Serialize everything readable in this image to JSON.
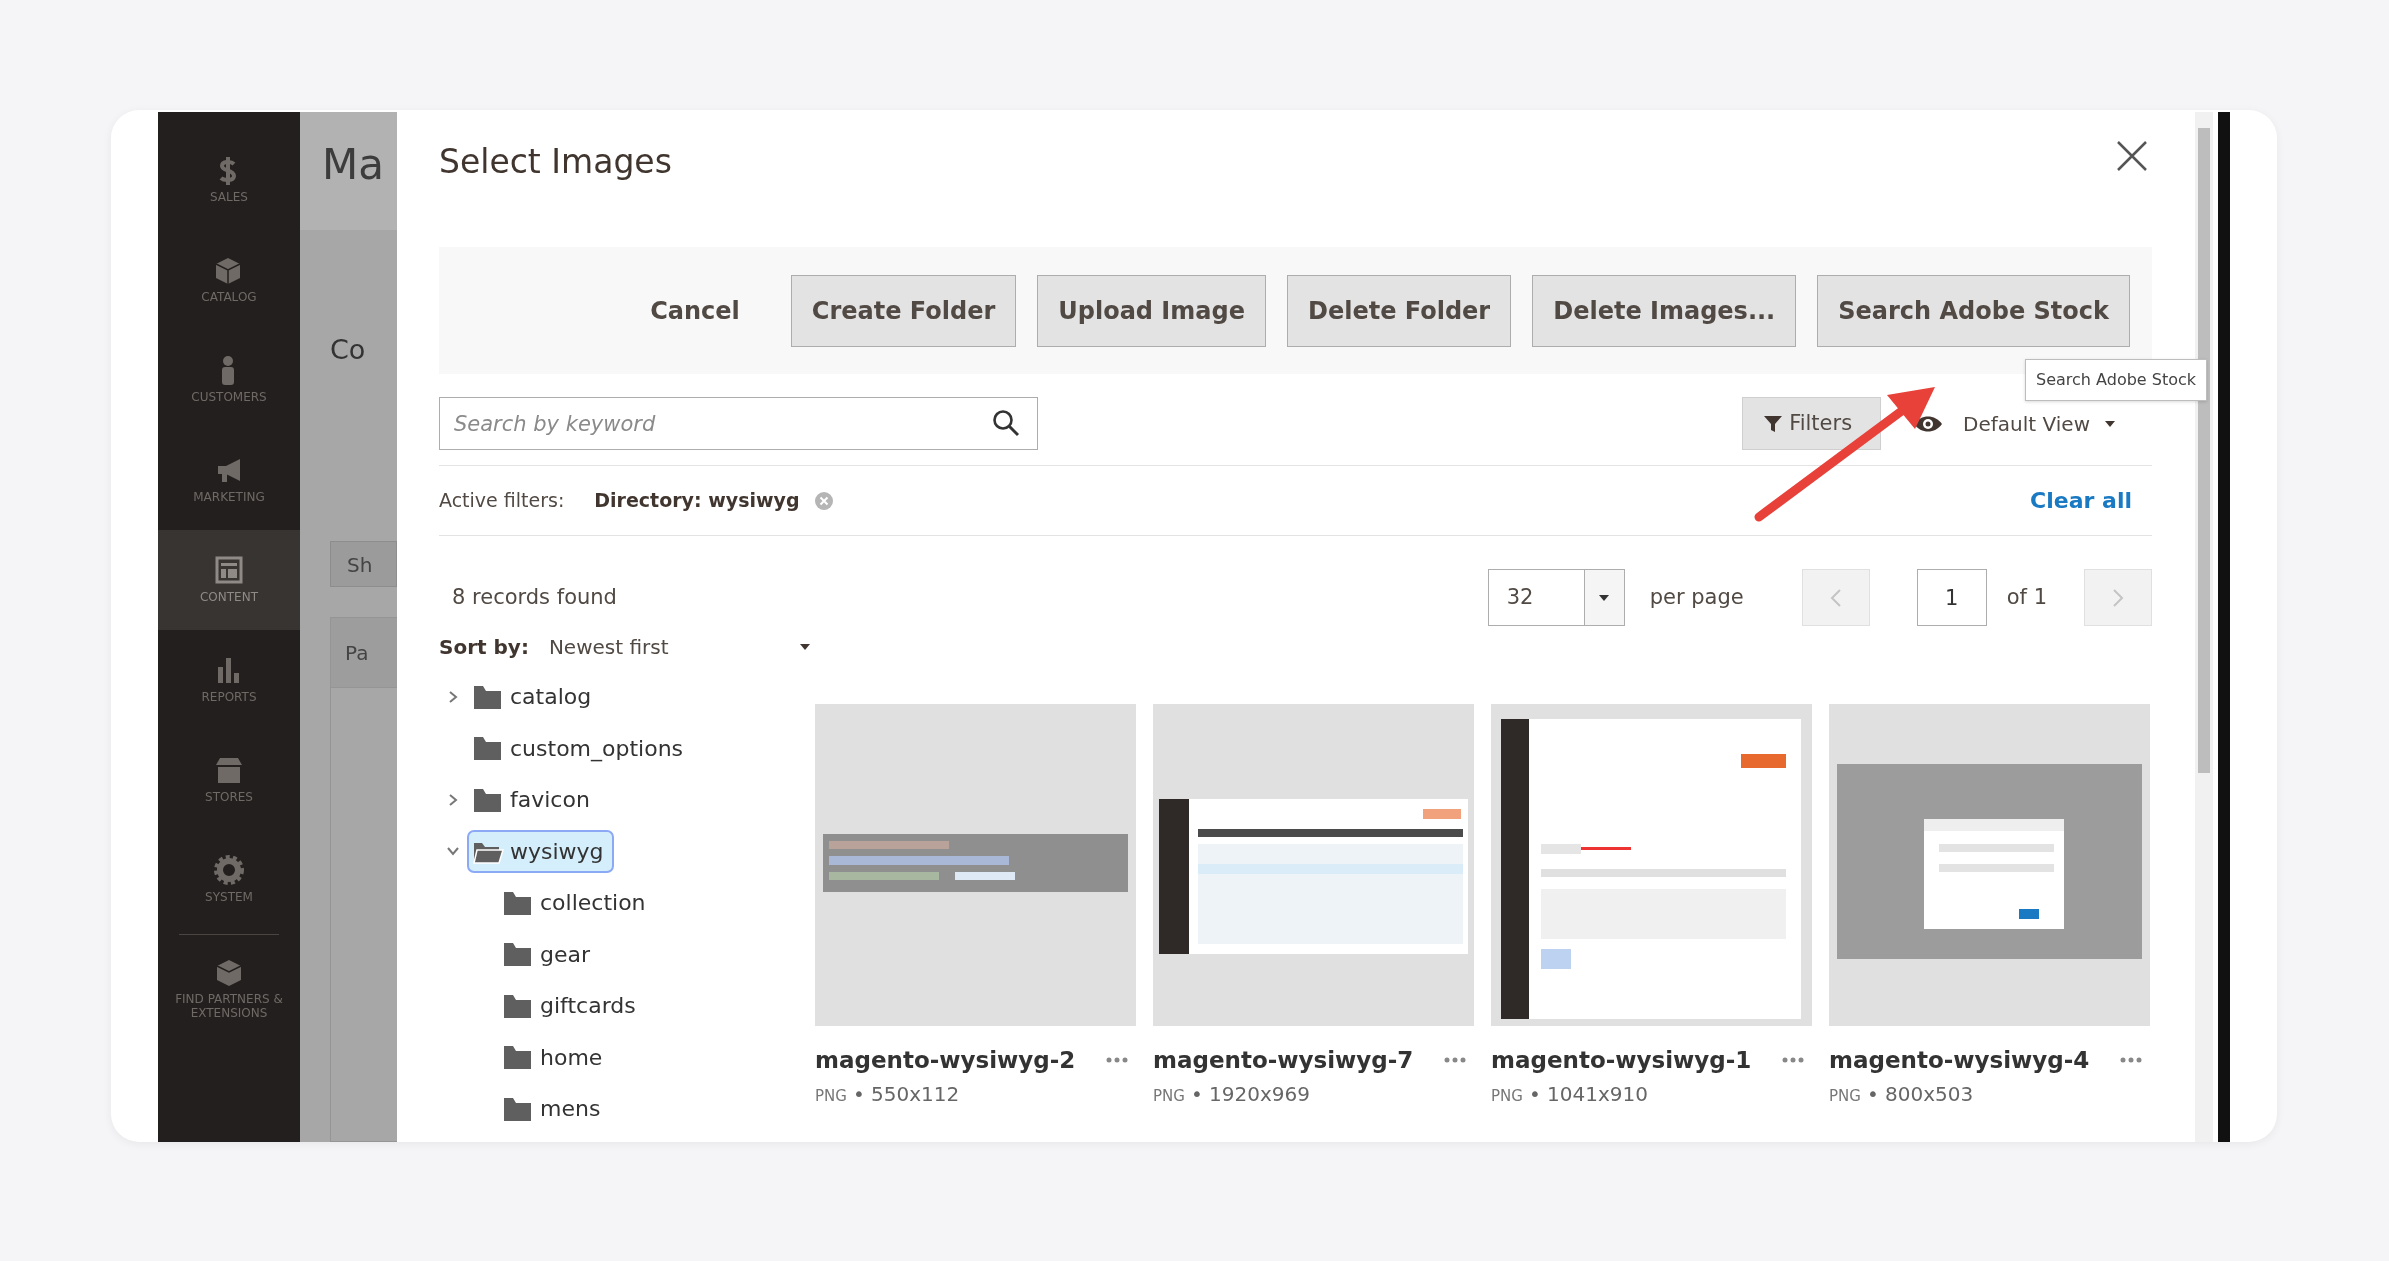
{
  "admin_sidebar": {
    "items": [
      {
        "label": "SALES",
        "selected": false
      },
      {
        "label": "CATALOG",
        "selected": false
      },
      {
        "label": "CUSTOMERS",
        "selected": false
      },
      {
        "label": "MARKETING",
        "selected": false
      },
      {
        "label": "CONTENT",
        "selected": true
      },
      {
        "label": "REPORTS",
        "selected": false
      },
      {
        "label": "STORES",
        "selected": false
      },
      {
        "label": "SYSTEM",
        "selected": false
      },
      {
        "label": "FIND PARTNERS & EXTENSIONS",
        "selected": false
      }
    ]
  },
  "background_page": {
    "title": "Ma",
    "heading": "Co",
    "button": "Sh",
    "panel_tab": "Pa"
  },
  "modal": {
    "title": "Select Images",
    "toolbar": [
      {
        "label": "Cancel",
        "kind": "link"
      },
      {
        "label": "Create Folder",
        "kind": "button"
      },
      {
        "label": "Upload Image",
        "kind": "button"
      },
      {
        "label": "Delete Folder",
        "kind": "button"
      },
      {
        "label": "Delete Images...",
        "kind": "button"
      },
      {
        "label": "Search Adobe Stock",
        "kind": "button"
      }
    ],
    "tooltip": "Search Adobe Stock",
    "search": {
      "placeholder": "Search by keyword"
    },
    "filters_button": "Filters",
    "view": "Default View",
    "active_filters": {
      "label": "Active filters:",
      "chips": [
        "Directory: wysiwyg"
      ],
      "clear": "Clear all"
    },
    "records": "8 records found",
    "per_page": {
      "value": "32",
      "label": "per page"
    },
    "pagination": {
      "page": "1",
      "of": "of 1"
    },
    "sort": {
      "label": "Sort by:",
      "value": "Newest first"
    },
    "tree": [
      {
        "label": "catalog",
        "expanded": false,
        "selected": false
      },
      {
        "label": "custom_options",
        "selected": false
      },
      {
        "label": "favicon",
        "expanded": false,
        "selected": false
      },
      {
        "label": "wysiwyg",
        "expanded": true,
        "selected": true,
        "children": [
          {
            "label": "collection",
            "selected": false
          },
          {
            "label": "gear",
            "selected": false
          },
          {
            "label": "giftcards",
            "selected": false
          },
          {
            "label": "home",
            "selected": false
          },
          {
            "label": "mens",
            "selected": false
          }
        ]
      }
    ],
    "images": [
      {
        "name": "magento-wysiwyg-2",
        "format": "PNG",
        "size": "• 550x112"
      },
      {
        "name": "magento-wysiwyg-7",
        "format": "PNG",
        "size": "• 1920x969"
      },
      {
        "name": "magento-wysiwyg-1",
        "format": "PNG",
        "size": "• 1041x910"
      },
      {
        "name": "magento-wysiwyg-4",
        "format": "PNG",
        "size": "• 800x503"
      }
    ]
  }
}
